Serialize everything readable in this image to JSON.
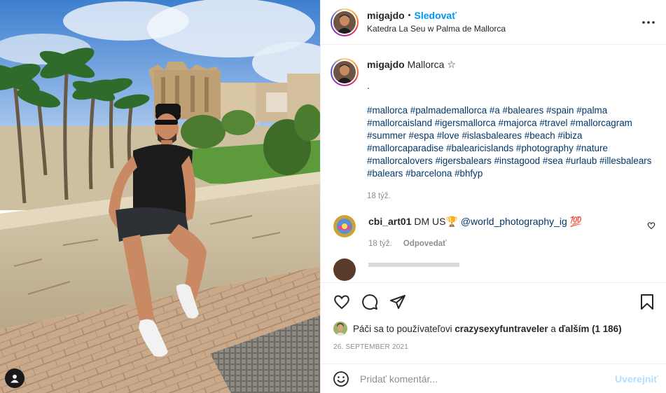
{
  "post": {
    "username": "migajdo",
    "follow_label": "Sledovať",
    "separator": "•",
    "location": "Katedra La Seu w Palma de Mallorca",
    "more_icon": "more-horizontal-icon"
  },
  "caption": {
    "username": "migajdo",
    "title": "Mallorca ☆",
    "dot_line": ".",
    "hashtags": "#mallorca #palmademallorca #a #baleares #spain #palma #mallorcaisland #igersmallorca #majorca #travel #mallorcagram #summer #espa #love #islasbaleares #beach #ibiza #mallorcaparadise #balearicislands #photography #nature #mallorcalovers #igersbalears #instagood #sea #urlaub #illesbalears #balears #barcelona #bhfyp",
    "time": "18 týž."
  },
  "comments": [
    {
      "username": "cbi_art01",
      "text": "DM US🏆",
      "mention": "@world_photography_ig",
      "suffix": "💯",
      "time": "18 týž.",
      "reply_label": "Odpovedať"
    }
  ],
  "likes": {
    "prefix": "Páči sa to používateľovi",
    "user": "crazysexyfuntraveler",
    "middle": "a",
    "others": "ďalším (1 186)"
  },
  "date": "26. SEPTEMBER 2021",
  "add_comment": {
    "placeholder": "Pridať komentár...",
    "post_label": "Uverejniť"
  },
  "colors": {
    "accent": "#0095f6",
    "link": "#00376b",
    "muted": "#8e8e8e",
    "post_disabled": "#b2dffc"
  },
  "icons": [
    "heart-icon",
    "comment-icon",
    "share-icon",
    "bookmark-icon",
    "emoji-icon",
    "user-tag-icon"
  ]
}
